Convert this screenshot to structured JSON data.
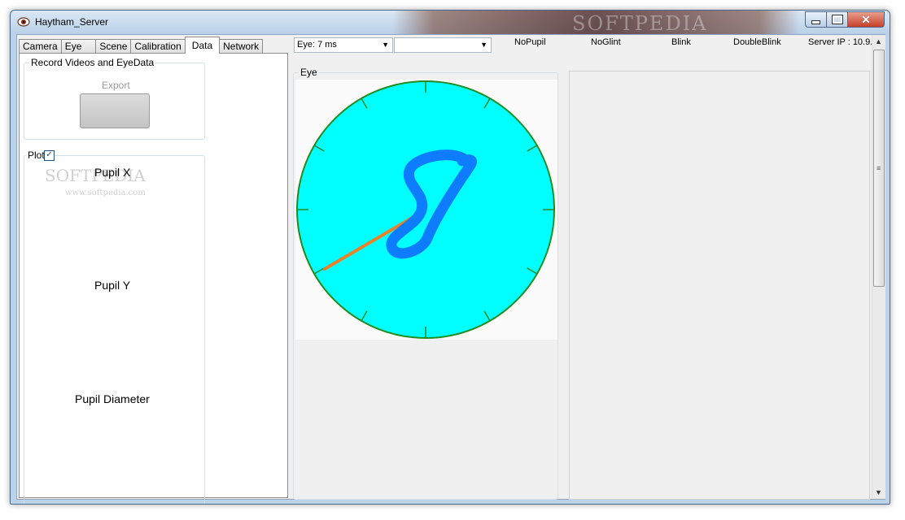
{
  "window": {
    "title": "Haytham_Server",
    "watermark": "SOFTPEDIA"
  },
  "tabs": [
    {
      "label": "Camera",
      "active": false
    },
    {
      "label": "Eye",
      "active": false
    },
    {
      "label": "Scene",
      "active": false
    },
    {
      "label": "Calibration",
      "active": false
    },
    {
      "label": "Data",
      "active": true
    },
    {
      "label": "Network",
      "active": false
    }
  ],
  "record": {
    "group_label": "Record Videos and EyeData",
    "export_label": "Export"
  },
  "plot": {
    "label": "Plot",
    "checked": true,
    "titles": [
      "Pupil X",
      "Pupil Y",
      "Pupil Diameter"
    ],
    "watermark": "SOFTPEDIA",
    "watermark_url": "www.softpedia.com"
  },
  "toolbar": {
    "eye_combo_value": "Eye: 7 ms",
    "second_combo_value": "",
    "status": [
      "NoPupil",
      "NoGlint",
      "Blink",
      "DoubleBlink"
    ],
    "server_ip": "Server IP : 10.9."
  },
  "eye_group": {
    "label": "Eye"
  },
  "colors": {
    "dial_fill": "#00ffff",
    "dial_stroke": "#228b22",
    "digit": "#0d7cff",
    "needle": "#e7812a"
  },
  "icons": {
    "app": "eye-icon",
    "minimize": "minimize-icon",
    "maximize": "maximize-icon",
    "close": "close-icon"
  }
}
